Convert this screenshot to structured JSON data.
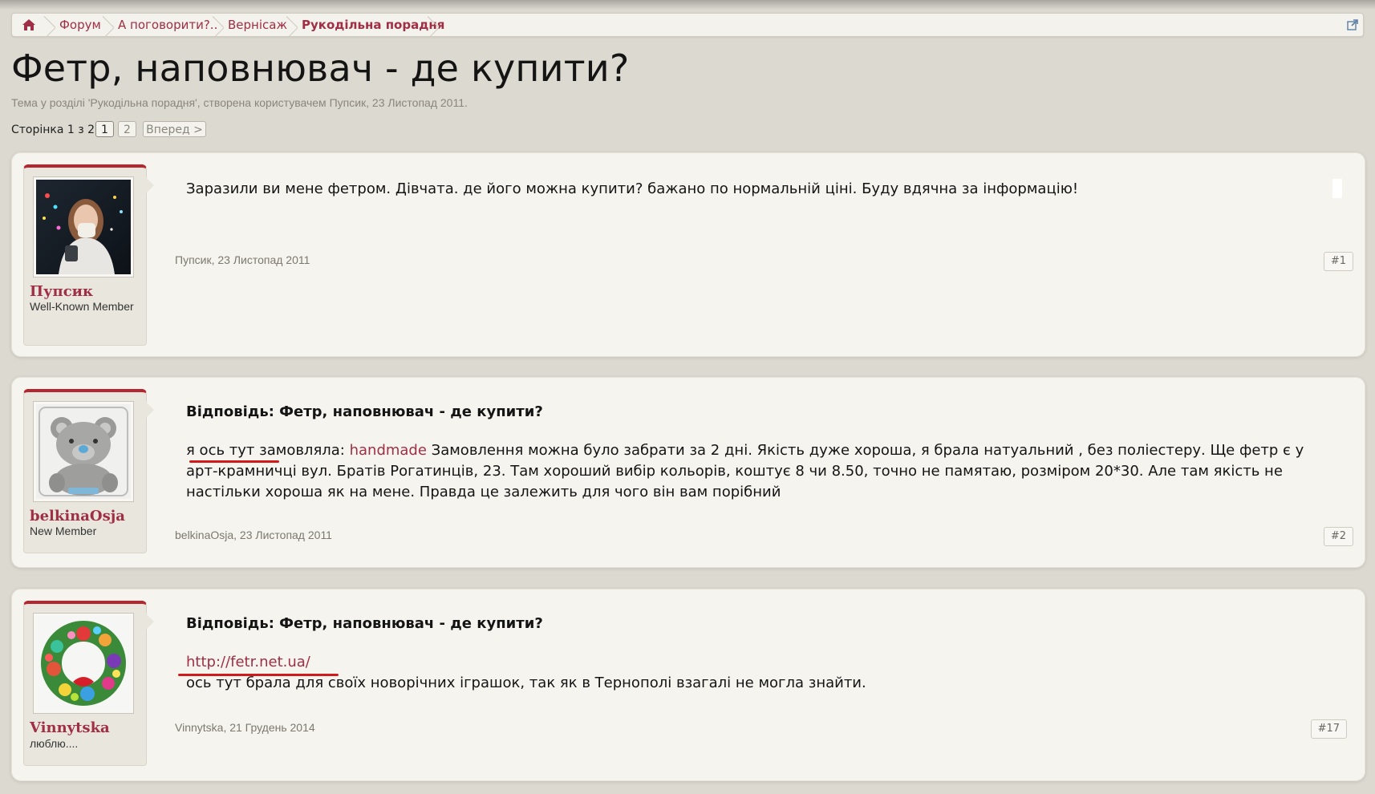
{
  "breadcrumb": {
    "home_icon": "home-icon",
    "items": [
      "Форум",
      "А поговорити?..",
      "Вернісаж",
      "Рукодільна порадня"
    ],
    "expand_icon": "external-link-icon"
  },
  "thread": {
    "title": "Фетр, наповнювач - де купити?",
    "subtitle": "Тема у розділі 'Рукодільна порадня', створена користувачем Пупсик, 23 Листопад 2011."
  },
  "pagination": {
    "label": "Сторінка 1 з 2",
    "pages": [
      "1",
      "2"
    ],
    "next": "Вперед >"
  },
  "posts": [
    {
      "username": "Пупсик",
      "rank": "Well-Known Member",
      "title": "",
      "text": "Заразили ви мене фетром. Дівчата. де його можна купити? бажано по нормальній ціні. Буду вдячна за інформацію!",
      "meta": "Пупсик, 23 Листопад 2011",
      "number": "#1"
    },
    {
      "username": "belkinaOsja",
      "rank": "New Member",
      "title": "Відповідь: Фетр, наповнювач - де купити?",
      "text_before": "я ось тут замовляла:",
      "link": " handmade ",
      "text_after": "Замовлення можна було забрати за 2 дні. Якість дуже хороша, я брала натуальний , без поліестеру. Ще фетр є у арт-крамничці вул. Братів Рогатинців, 23. Там хороший вибір кольорів, коштує 8 чи 8.50, точно не памятаю, розміром 20*30. Але там якість не настільки хороша як на мене. Правда це залежить для чого він вам порібний",
      "meta": "belkinaOsja, 23 Листопад 2011",
      "number": "#2"
    },
    {
      "username": "Vinnytska",
      "rank": "люблю....",
      "title": "Відповідь: Фетр, наповнювач - де купити?",
      "link": "http://fetr.net.ua/",
      "text": "ось тут брала для своїх новорічних іграшок, так як в Тернополі взагалі не могла знайти.",
      "meta": "Vinnytska, 21 Грудень 2014",
      "number": "#17"
    }
  ],
  "colors": {
    "background": "#dcd9d0",
    "accent": "#a02f46",
    "userblock_top": "#b5262f",
    "annotation": "#d11a1a"
  }
}
